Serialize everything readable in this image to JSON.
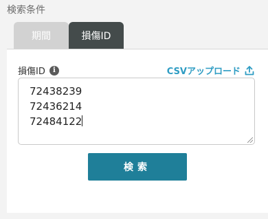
{
  "section": {
    "title": "検索条件"
  },
  "tabs": [
    {
      "label": "期間",
      "active": false
    },
    {
      "label": "損傷ID",
      "active": true
    }
  ],
  "form": {
    "field_label": "損傷ID",
    "info_icon": "i",
    "csv_label": "CSVアップロード",
    "ids": [
      "72438239",
      "72436214",
      "72484122"
    ],
    "search_label": "検索"
  },
  "colors": {
    "accent": "#2e9cc3",
    "button": "#1f7f99",
    "active_tab": "#444b4b",
    "inactive_tab": "#d2d2d2"
  }
}
